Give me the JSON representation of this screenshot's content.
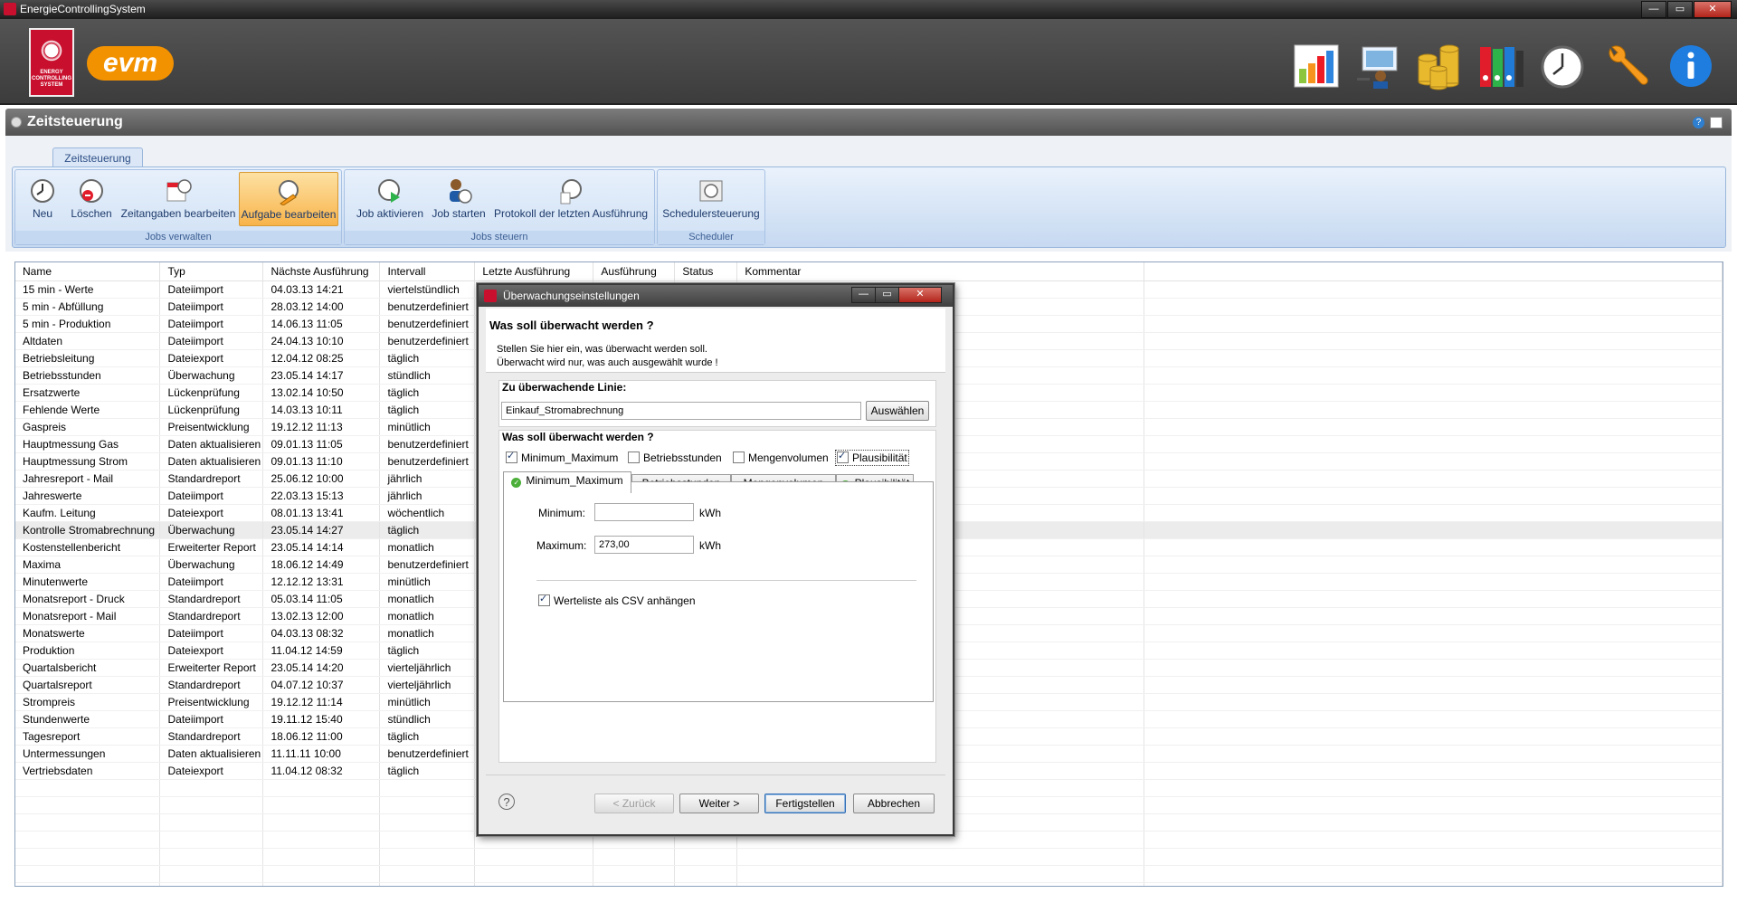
{
  "window": {
    "title": "EnergieControllingSystem",
    "controls": [
      "—",
      "▭",
      "✕"
    ]
  },
  "logos": {
    "ecs_text": "ENERGY CONTROLLING SYSTEM",
    "evm_text": "evm"
  },
  "header_icons": [
    "chart-icon",
    "presentation-icon",
    "coins-icon",
    "folders-icon",
    "clock-icon",
    "wrench-icon",
    "info-icon"
  ],
  "panel": {
    "title": "Zeitsteuerung"
  },
  "ribbon": {
    "tab_label": "Zeitsteuerung",
    "groups": [
      {
        "label": "Jobs verwalten",
        "buttons": [
          "Neu",
          "Löschen",
          "Zeitangaben bearbeiten",
          "Aufgabe bearbeiten"
        ]
      },
      {
        "label": "Jobs steuern",
        "buttons": [
          "Job aktivieren",
          "Job starten",
          "Protokoll der letzten Ausführung"
        ]
      },
      {
        "label": "Scheduler",
        "buttons": [
          "Schedulersteuerung"
        ]
      }
    ],
    "active_button": "Aufgabe bearbeiten"
  },
  "table": {
    "columns": [
      "Name",
      "Typ",
      "Nächste Ausführung",
      "Intervall",
      "Letzte Ausführung",
      "Ausführung",
      "Status",
      "Kommentar"
    ],
    "rows": [
      [
        "15 min - Werte",
        "Dateiimport",
        "04.03.13 14:21",
        "viertelstündlich"
      ],
      [
        "5 min - Abfüllung",
        "Dateiimport",
        "28.03.12 14:00",
        "benutzerdefiniert"
      ],
      [
        "5 min - Produktion",
        "Dateiimport",
        "14.06.13 11:05",
        "benutzerdefiniert"
      ],
      [
        "Altdaten",
        "Dateiimport",
        "24.04.13 10:10",
        "benutzerdefiniert"
      ],
      [
        "Betriebsleitung",
        "Dateiexport",
        "12.04.12 08:25",
        "täglich"
      ],
      [
        "Betriebsstunden",
        "Überwachung",
        "23.05.14 14:17",
        "stündlich"
      ],
      [
        "Ersatzwerte",
        "Lückenprüfung",
        "13.02.14 10:50",
        "täglich"
      ],
      [
        "Fehlende Werte",
        "Lückenprüfung",
        "14.03.13 10:11",
        "täglich"
      ],
      [
        "Gaspreis",
        "Preisentwicklung",
        "19.12.12 11:13",
        "minütlich"
      ],
      [
        "Hauptmessung Gas",
        "Daten aktualisieren",
        "09.01.13 11:05",
        "benutzerdefiniert"
      ],
      [
        "Hauptmessung Strom",
        "Daten aktualisieren",
        "09.01.13 11:10",
        "benutzerdefiniert"
      ],
      [
        "Jahresreport - Mail",
        "Standardreport",
        "25.06.12 10:00",
        "jährlich"
      ],
      [
        "Jahreswerte",
        "Dateiimport",
        "22.03.13 15:13",
        "jährlich"
      ],
      [
        "Kaufm. Leitung",
        "Dateiexport",
        "08.01.13 13:41",
        "wöchentlich"
      ],
      [
        "Kontrolle Stromabrechnung",
        "Überwachung",
        "23.05.14 14:27",
        "täglich"
      ],
      [
        "Kostenstellenbericht",
        "Erweiterter Report",
        "23.05.14 14:14",
        "monatlich"
      ],
      [
        "Maxima",
        "Überwachung",
        "18.06.12 14:49",
        "benutzerdefiniert"
      ],
      [
        "Minutenwerte",
        "Dateiimport",
        "12.12.12 13:31",
        "minütlich"
      ],
      [
        "Monatsreport - Druck",
        "Standardreport",
        "05.03.14 11:05",
        "monatlich"
      ],
      [
        "Monatsreport - Mail",
        "Standardreport",
        "13.02.13 12:00",
        "monatlich"
      ],
      [
        "Monatswerte",
        "Dateiimport",
        "04.03.13 08:32",
        "monatlich"
      ],
      [
        "Produktion",
        "Dateiexport",
        "11.04.12 14:59",
        "täglich"
      ],
      [
        "Quartalsbericht",
        "Erweiterter Report",
        "23.05.14 14:20",
        "vierteljährlich"
      ],
      [
        "Quartalsreport",
        "Standardreport",
        "04.07.12 10:37",
        "vierteljährlich"
      ],
      [
        "Strompreis",
        "Preisentwicklung",
        "19.12.12 11:14",
        "minütlich"
      ],
      [
        "Stundenwerte",
        "Dateiimport",
        "19.11.12 15:40",
        "stündlich"
      ],
      [
        "Tagesreport",
        "Standardreport",
        "18.06.12 11:00",
        "täglich"
      ],
      [
        "Untermessungen",
        "Daten aktualisieren",
        "11.11.11 10:00",
        "benutzerdefiniert"
      ],
      [
        "Vertriebsdaten",
        "Dateiexport",
        "11.04.12 08:32",
        "täglich"
      ]
    ],
    "selected_row": "Kontrolle Stromabrechnung"
  },
  "dialog": {
    "title": "Überwachungseinstellungen",
    "heading": "Was soll überwacht werden ?",
    "description": [
      "Stellen Sie hier ein, was überwacht werden soll.",
      "Überwacht wird nur, was auch ausgewählt wurde !"
    ],
    "line_group": {
      "title": "Zu überwachende Linie:",
      "value": "Einkauf_Stromabrechnung",
      "select_button": "Auswählen"
    },
    "monitor_group": {
      "title": "Was soll überwacht werden ?",
      "checkboxes": [
        {
          "label": "Minimum_Maximum",
          "checked": true
        },
        {
          "label": "Betriebsstunden",
          "checked": false
        },
        {
          "label": "Mengenvolumen",
          "checked": false
        },
        {
          "label": "Plausibilität",
          "checked": true
        }
      ],
      "tabs": [
        {
          "label": "Minimum_Maximum",
          "ok": true
        },
        {
          "label": "Betriebsstunden",
          "ok": false
        },
        {
          "label": "Mengenvolumen",
          "ok": false
        },
        {
          "label": "Plausibilität",
          "ok": true
        }
      ],
      "active_tab": "Minimum_Maximum",
      "minimum": {
        "label": "Minimum:",
        "value": "",
        "unit": "kWh"
      },
      "maximum": {
        "label": "Maximum:",
        "value": "273,00",
        "unit": "kWh"
      },
      "csv": {
        "label": "Werteliste als CSV anhängen",
        "checked": true
      }
    },
    "buttons": {
      "back": "< Zurück",
      "next": "Weiter >",
      "finish": "Fertigstellen",
      "cancel": "Abbrechen"
    }
  }
}
